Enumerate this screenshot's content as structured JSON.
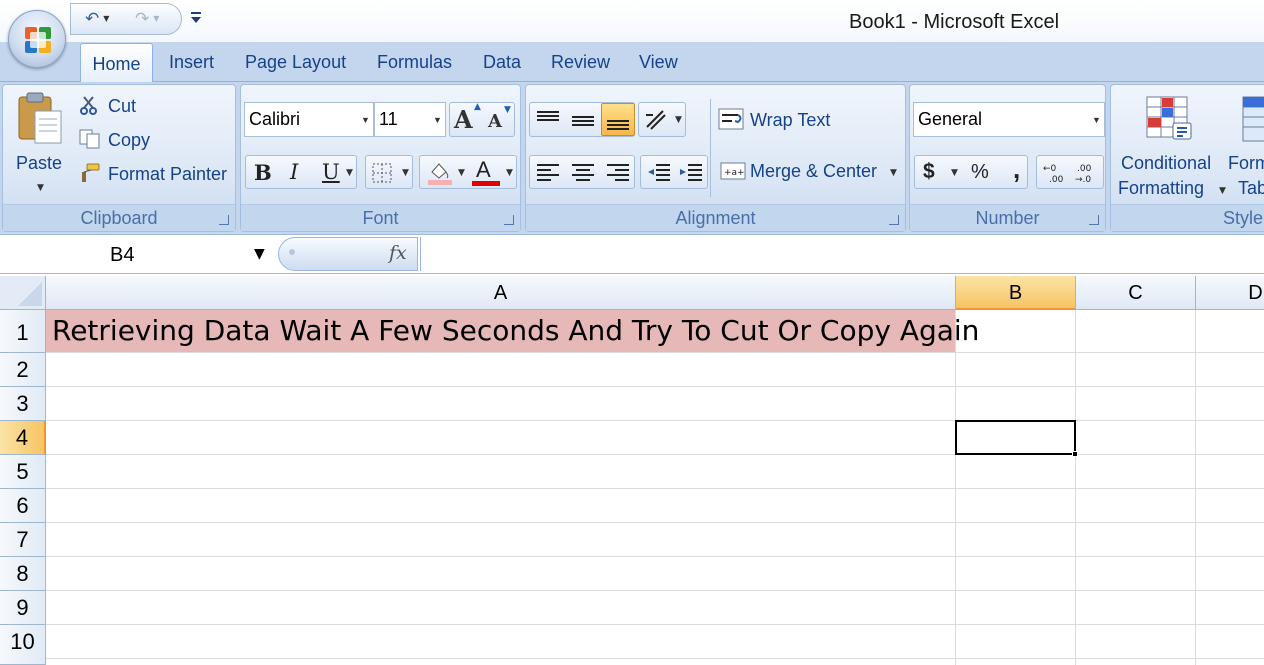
{
  "window": {
    "title": "Book1 - Microsoft Excel"
  },
  "quick_access": {
    "undo_icon": "undo-icon",
    "redo_icon": "redo-icon",
    "customize_icon": "customize-qat-icon"
  },
  "tabs": [
    {
      "label": "Home",
      "active": true
    },
    {
      "label": "Insert"
    },
    {
      "label": "Page Layout"
    },
    {
      "label": "Formulas"
    },
    {
      "label": "Data"
    },
    {
      "label": "Review"
    },
    {
      "label": "View"
    }
  ],
  "ribbon": {
    "clipboard": {
      "label": "Clipboard",
      "paste": "Paste",
      "cut": "Cut",
      "copy": "Copy",
      "format_painter": "Format Painter"
    },
    "font": {
      "label": "Font",
      "font_name": "Calibri",
      "font_size": "11",
      "bold": "B",
      "italic": "I",
      "underline": "U",
      "grow": "A",
      "shrink": "A",
      "font_color_glyph": "A",
      "font_color": "#e00000",
      "highlight_color": "#f7b0b0"
    },
    "alignment": {
      "label": "Alignment",
      "wrap_text": "Wrap Text",
      "merge_center": "Merge & Center"
    },
    "number": {
      "label": "Number",
      "format": "General",
      "currency": "$",
      "percent": "%",
      "comma": ","
    },
    "styles": {
      "label": "Style",
      "conditional_line1": "Conditional",
      "conditional_line2": "Formatting",
      "format_table_line1": "Form",
      "format_table_line2": "Tab"
    }
  },
  "formula_bar": {
    "name_box": "B4",
    "fx": "fx",
    "formula": ""
  },
  "grid": {
    "columns": [
      "A",
      "B",
      "C",
      "D"
    ],
    "selected_column": "B",
    "rows": [
      "1",
      "2",
      "3",
      "4",
      "5",
      "6",
      "7",
      "8",
      "9",
      "10"
    ],
    "selected_row": "4",
    "cells": {
      "A1": "Retrieving Data Wait A Few Seconds And Try To Cut Or Copy Again"
    },
    "a1_fill_color": "#e6b8b7",
    "active_cell": "B4"
  }
}
